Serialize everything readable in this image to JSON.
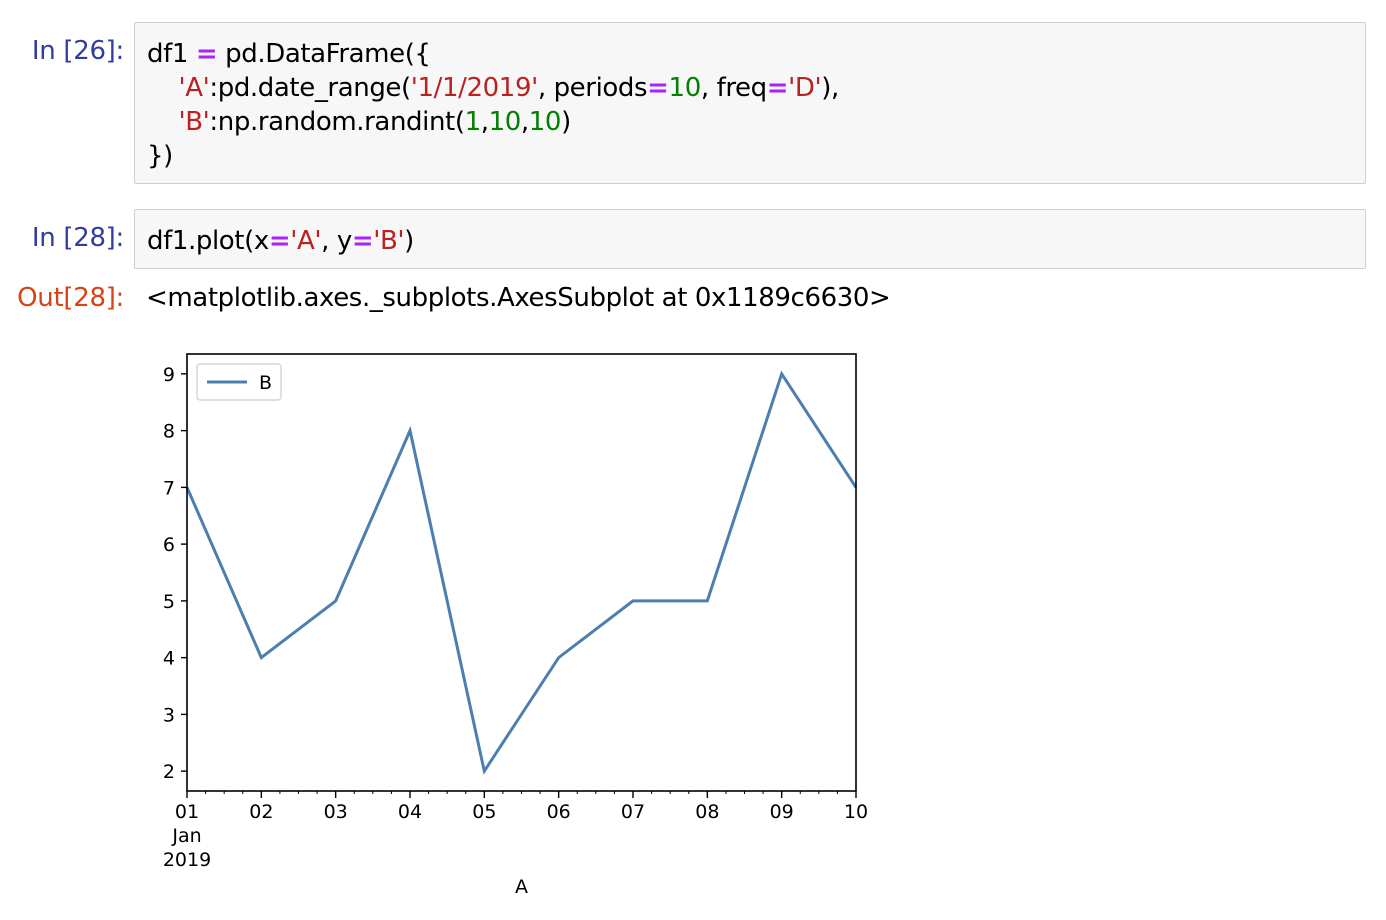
{
  "cells": [
    {
      "prompt": "In [26]:",
      "lines": [
        [
          {
            "t": "df1 ",
            "c": ""
          },
          {
            "t": "=",
            "c": "op"
          },
          {
            "t": " pd.DataFrame({",
            "c": ""
          }
        ],
        [
          {
            "t": "    ",
            "c": ""
          },
          {
            "t": "'A'",
            "c": "str"
          },
          {
            "t": ":pd.date_range(",
            "c": ""
          },
          {
            "t": "'1/1/2019'",
            "c": "str"
          },
          {
            "t": ", periods",
            "c": ""
          },
          {
            "t": "=",
            "c": "op"
          },
          {
            "t": "10",
            "c": "num"
          },
          {
            "t": ", freq",
            "c": ""
          },
          {
            "t": "=",
            "c": "op"
          },
          {
            "t": "'D'",
            "c": "str"
          },
          {
            "t": "),",
            "c": ""
          }
        ],
        [
          {
            "t": "    ",
            "c": ""
          },
          {
            "t": "'B'",
            "c": "str"
          },
          {
            "t": ":np.random.randint(",
            "c": ""
          },
          {
            "t": "1",
            "c": "num"
          },
          {
            "t": ",",
            "c": ""
          },
          {
            "t": "10",
            "c": "num"
          },
          {
            "t": ",",
            "c": ""
          },
          {
            "t": "10",
            "c": "num"
          },
          {
            "t": ")",
            "c": ""
          }
        ],
        [
          {
            "t": "})",
            "c": ""
          }
        ]
      ]
    },
    {
      "prompt": "In [28]:",
      "lines": [
        [
          {
            "t": "df1.plot(x",
            "c": ""
          },
          {
            "t": "=",
            "c": "op"
          },
          {
            "t": "'A'",
            "c": "str"
          },
          {
            "t": ", y",
            "c": ""
          },
          {
            "t": "=",
            "c": "op"
          },
          {
            "t": "'B'",
            "c": "str"
          },
          {
            "t": ")",
            "c": ""
          }
        ]
      ]
    }
  ],
  "output": {
    "prompt": "Out[28]:",
    "text": "<matplotlib.axes._subplots.AxesSubplot at 0x1189c6630>"
  },
  "colors": {
    "line": "#4c7fb0",
    "operator": "#aa22ff",
    "string": "#ba2121",
    "number": "#008000",
    "in_prompt": "#303f9f",
    "out_prompt": "#d84315"
  },
  "chart_data": {
    "type": "line",
    "x": [
      "2019-01-01",
      "2019-01-02",
      "2019-01-03",
      "2019-01-04",
      "2019-01-05",
      "2019-01-06",
      "2019-01-07",
      "2019-01-08",
      "2019-01-09",
      "2019-01-10"
    ],
    "x_tick_labels": [
      "01",
      "02",
      "03",
      "04",
      "05",
      "06",
      "07",
      "08",
      "09",
      "10"
    ],
    "x_tick_sublabels": [
      "Jan",
      "2019"
    ],
    "series": [
      {
        "name": "B",
        "values": [
          7,
          4,
          5,
          8,
          2,
          4,
          5,
          5,
          9,
          7
        ]
      }
    ],
    "xlabel": "A",
    "ylabel": "",
    "ylim": [
      1.65,
      9.35
    ],
    "yticks": [
      2,
      3,
      4,
      5,
      6,
      7,
      8,
      9
    ],
    "grid": false,
    "legend": "upper left"
  }
}
